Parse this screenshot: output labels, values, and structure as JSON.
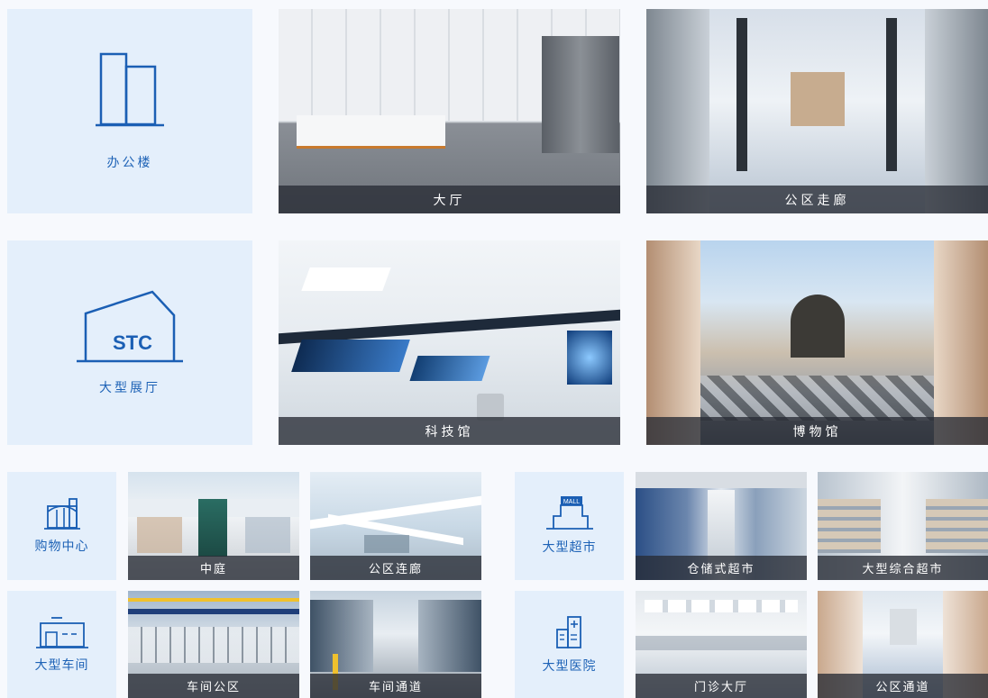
{
  "colors": {
    "accent": "#1b5fb4",
    "tile_bg": "#e4effb",
    "caption_bg": "#2c3038"
  },
  "row1": {
    "category": {
      "label": "办公楼",
      "icon": "office-building-icon"
    },
    "photos": [
      {
        "caption": "大厅"
      },
      {
        "caption": "公区走廊"
      }
    ]
  },
  "row2": {
    "category": {
      "label": "大型展厅",
      "icon": "showroom-stc-icon",
      "icon_text": "STC"
    },
    "photos": [
      {
        "caption": "科技馆"
      },
      {
        "caption": "博物馆"
      }
    ]
  },
  "small_groups": [
    {
      "label": "购物中心",
      "icon": "shopping-center-icon",
      "photos": [
        {
          "caption": "中庭"
        },
        {
          "caption": "公区连廊"
        }
      ]
    },
    {
      "label": "大型超市",
      "icon": "supermarket-mall-icon",
      "icon_text": "MALL",
      "photos": [
        {
          "caption": "仓储式超市"
        },
        {
          "caption": "大型综合超市"
        }
      ]
    },
    {
      "label": "大型车间",
      "icon": "workshop-icon",
      "photos": [
        {
          "caption": "车间公区"
        },
        {
          "caption": "车间通道"
        }
      ]
    },
    {
      "label": "大型医院",
      "icon": "hospital-icon",
      "photos": [
        {
          "caption": "门诊大厅"
        },
        {
          "caption": "公区通道"
        }
      ]
    }
  ]
}
